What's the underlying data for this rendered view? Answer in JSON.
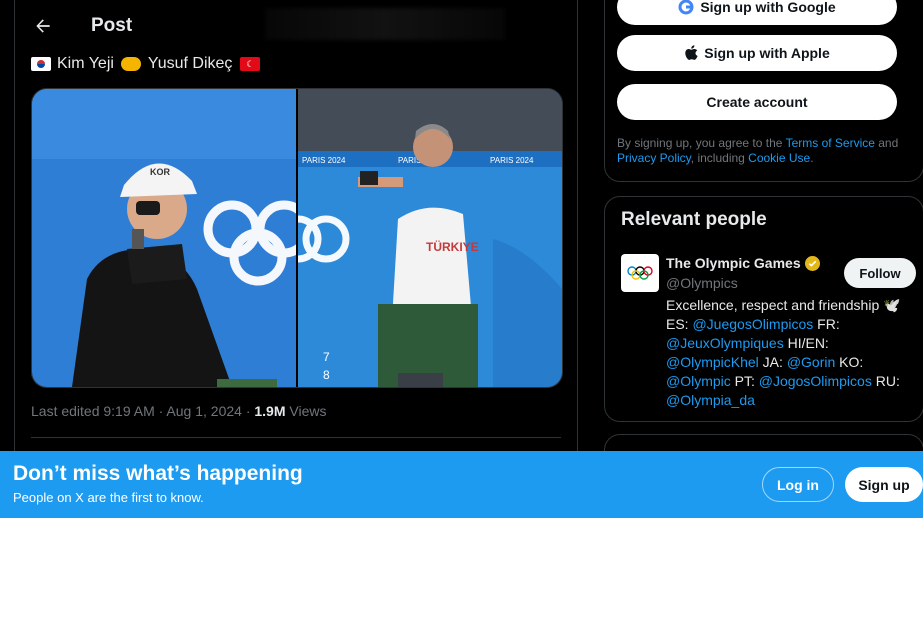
{
  "header": {
    "title": "Post"
  },
  "post": {
    "name_left": "Kim Yeji",
    "name_right": "Yusuf Dikeç",
    "media_left_badge": "KOR",
    "media_right_banner": "PARIS 2024",
    "media_right_shirt": "TÜRKIYE",
    "media_right_numbers": [
      "7",
      "8"
    ],
    "timestamp": "Last edited 9:19 AM · Aug 1, 2024 · ",
    "views_count": "1.9M",
    "views_label": " Views"
  },
  "signup": {
    "google_label": "Sign up with Google",
    "apple_label": "Sign up with Apple",
    "create_label": "Create account",
    "terms_prefix": "By signing up, you agree to the ",
    "terms_link": "Terms of Service",
    "terms_and": " and ",
    "privacy_link": "Privacy Policy",
    "terms_including": ", including ",
    "cookie_link": "Cookie Use",
    "terms_end": "."
  },
  "relevant": {
    "title": "Relevant people",
    "account": {
      "name": "The Olympic Games",
      "handle": "@Olympics",
      "follow_label": "Follow",
      "bio": [
        {
          "t": "Excellence, respect and friendship 🕊️",
          "link": false
        },
        {
          "t": "ES: ",
          "link": false
        },
        {
          "t": "@JuegosOlimpicos",
          "link": true
        },
        {
          "t": " FR: ",
          "link": false
        },
        {
          "t": "@JeuxOlympiques",
          "link": true
        },
        {
          "t": " HI/EN: ",
          "link": false
        },
        {
          "t": "@OlympicKhel",
          "link": true
        },
        {
          "t": " JA: ",
          "link": false
        },
        {
          "t": "@Gorin",
          "link": true
        },
        {
          "t": " KO: ",
          "link": false
        },
        {
          "t": "@Olympic",
          "link": true
        },
        {
          "t": " PT: ",
          "link": false
        },
        {
          "t": "@JogosOlimpicos",
          "link": true
        },
        {
          "t": " RU: ",
          "link": false
        },
        {
          "t": "@Olympia_da",
          "link": true
        }
      ]
    }
  },
  "banner": {
    "title": "Don’t miss what’s happening",
    "subtitle": "People on X are the first to know.",
    "login_label": "Log in",
    "signup_label": "Sign up"
  },
  "colors": {
    "accent": "#1d9bf0",
    "background": "#000000",
    "border": "#2f3336",
    "muted": "#71767b"
  }
}
